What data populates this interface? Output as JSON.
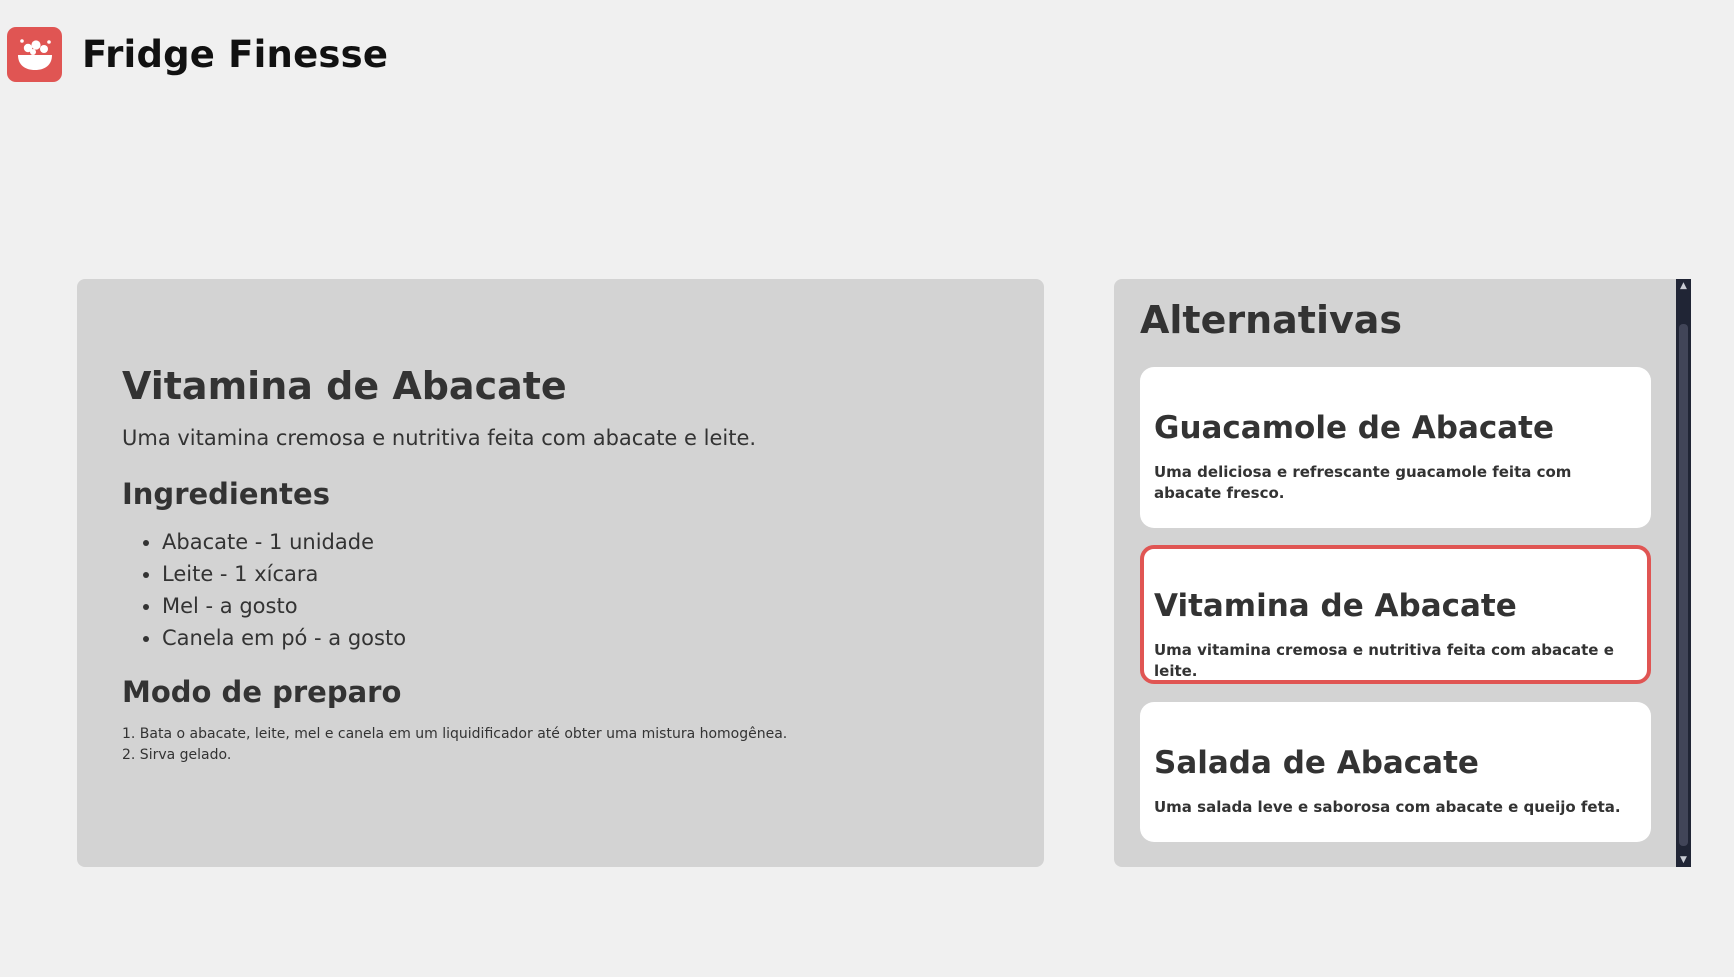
{
  "app": {
    "title": "Fridge Finesse",
    "logo_icon": "bowl-icon",
    "brand_color": "#e05553"
  },
  "recipe": {
    "title": "Vitamina de Abacate",
    "description": "Uma vitamina cremosa e nutritiva feita com abacate e leite.",
    "ingredients_heading": "Ingredientes",
    "ingredients": [
      "Abacate - 1 unidade",
      "Leite - 1 xícara",
      "Mel - a gosto",
      "Canela em pó - a gosto"
    ],
    "method_heading": "Modo de preparo",
    "method_steps": [
      "1. Bata o abacate, leite, mel e canela em um liquidificador até obter uma mistura homogênea.",
      "2. Sirva gelado."
    ]
  },
  "alternatives": {
    "heading": "Alternativas",
    "items": [
      {
        "title": "Guacamole de Abacate",
        "description": "Uma deliciosa e refrescante guacamole feita com abacate fresco.",
        "selected": false
      },
      {
        "title": "Vitamina de Abacate",
        "description": "Uma vitamina cremosa e nutritiva feita com abacate e leite.",
        "selected": true
      },
      {
        "title": "Salada de Abacate",
        "description": "Uma salada leve e saborosa com abacate e queijo feta.",
        "selected": false
      }
    ]
  },
  "scrollbar": {
    "up_icon": "chevron-up-icon",
    "down_icon": "chevron-down-icon"
  }
}
